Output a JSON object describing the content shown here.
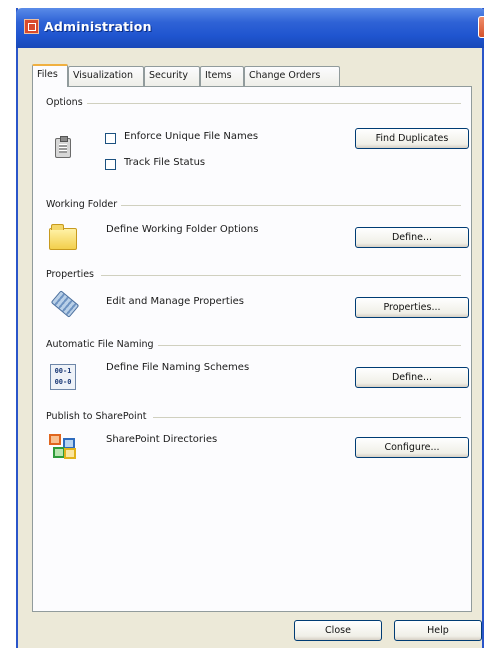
{
  "window": {
    "title": "Administration"
  },
  "tabs": [
    "Files",
    "Visualization",
    "Security",
    "Items",
    "Change Orders"
  ],
  "sections": {
    "options": {
      "label": "Options",
      "checkbox1": "Enforce Unique File Names",
      "checkbox2": "Track File Status",
      "checkbox1_checked": false,
      "checkbox2_checked": false,
      "button": "Find Duplicates"
    },
    "working_folder": {
      "label": "Working Folder",
      "description": "Define Working Folder Options",
      "button": "Define..."
    },
    "properties": {
      "label": "Properties",
      "description": "Edit and Manage Properties",
      "button": "Properties..."
    },
    "file_naming": {
      "label": "Automatic File Naming",
      "description": "Define File Naming Schemes",
      "button": "Define...",
      "icon_text_top": "00-1",
      "icon_text_bottom": "00-0"
    },
    "sharepoint": {
      "label": "Publish to SharePoint",
      "description": "SharePoint Directories",
      "button": "Configure..."
    }
  },
  "footer": {
    "close": "Close",
    "help": "Help"
  },
  "icons": {
    "app": "administration-app-icon",
    "close": "close-icon",
    "options": "clipboard-icon",
    "working_folder": "folder-icon",
    "properties": "tag-icon",
    "file_naming": "file-naming-icon",
    "sharepoint": "sharepoint-icon"
  }
}
